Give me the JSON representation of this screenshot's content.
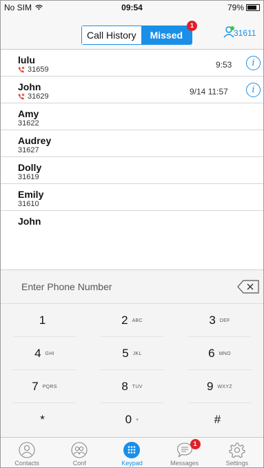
{
  "status_bar": {
    "carrier": "No SIM",
    "time": "09:54",
    "battery": "79%"
  },
  "header": {
    "tabs": [
      {
        "label": "Call History"
      },
      {
        "label": "Missed"
      }
    ],
    "missed_badge": "1",
    "account_number": "31611"
  },
  "calls": [
    {
      "name": "lulu",
      "number": "31659",
      "missed": true,
      "time": "9:53"
    },
    {
      "name": "John",
      "number": "31629",
      "missed": true,
      "time": "9/14 11:57"
    },
    {
      "name": "Amy",
      "number": "31622",
      "missed": false,
      "time": ""
    },
    {
      "name": "Audrey",
      "number": "31627",
      "missed": false,
      "time": ""
    },
    {
      "name": "Dolly",
      "number": "31619",
      "missed": false,
      "time": ""
    },
    {
      "name": "Emily",
      "number": "31610",
      "missed": false,
      "time": ""
    },
    {
      "name": "John",
      "number": "",
      "missed": false,
      "time": ""
    }
  ],
  "keypad": {
    "placeholder": "Enter Phone Number",
    "keys": [
      {
        "digit": "1",
        "letters": ""
      },
      {
        "digit": "2",
        "letters": "ABC"
      },
      {
        "digit": "3",
        "letters": "DEF"
      },
      {
        "digit": "4",
        "letters": "GHI"
      },
      {
        "digit": "5",
        "letters": "JKL"
      },
      {
        "digit": "6",
        "letters": "MNO"
      },
      {
        "digit": "7",
        "letters": "PQRS"
      },
      {
        "digit": "8",
        "letters": "TUV"
      },
      {
        "digit": "9",
        "letters": "WXYZ"
      },
      {
        "digit": "*",
        "letters": ""
      },
      {
        "digit": "0",
        "letters": "+"
      },
      {
        "digit": "#",
        "letters": ""
      }
    ]
  },
  "tabbar": [
    {
      "label": "Contacts",
      "icon": "contacts-icon",
      "active": false,
      "badge": ""
    },
    {
      "label": "Conf",
      "icon": "conference-icon",
      "active": false,
      "badge": ""
    },
    {
      "label": "Keypad",
      "icon": "keypad-icon",
      "active": true,
      "badge": ""
    },
    {
      "label": "Messages",
      "icon": "messages-icon",
      "active": false,
      "badge": "1"
    },
    {
      "label": "Settings",
      "icon": "gear-icon",
      "active": false,
      "badge": ""
    }
  ],
  "colors": {
    "accent": "#1a8fe8",
    "badge": "#e0202a",
    "missed_call": "#d9412b"
  }
}
